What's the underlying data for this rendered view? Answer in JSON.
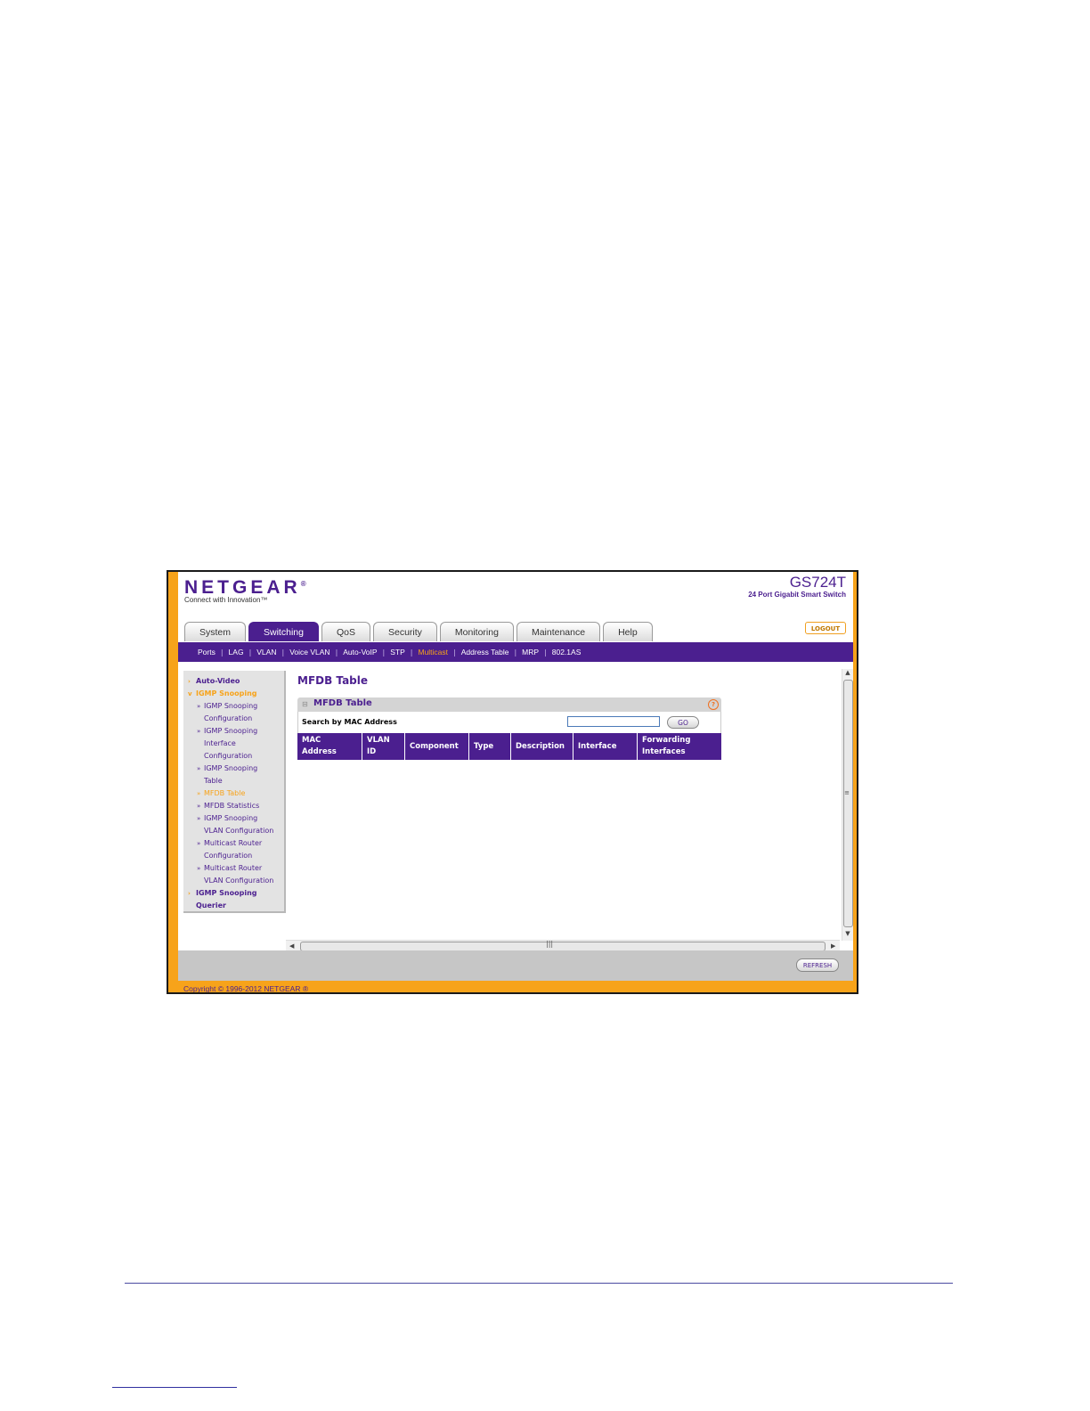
{
  "header": {
    "logo": "NETGEAR",
    "logo_mark": "®",
    "tagline": "Connect with Innovation™",
    "model": "GS724T",
    "model_desc": "24 Port Gigabit Smart Switch",
    "logout_label": "LOGOUT"
  },
  "tabs": [
    {
      "label": "System"
    },
    {
      "label": "Switching"
    },
    {
      "label": "QoS"
    },
    {
      "label": "Security"
    },
    {
      "label": "Monitoring"
    },
    {
      "label": "Maintenance"
    },
    {
      "label": "Help"
    }
  ],
  "subnav": [
    {
      "label": "Ports"
    },
    {
      "label": "LAG"
    },
    {
      "label": "VLAN"
    },
    {
      "label": "Voice VLAN"
    },
    {
      "label": "Auto-VoIP"
    },
    {
      "label": "STP"
    },
    {
      "label": "Multicast"
    },
    {
      "label": "Address Table"
    },
    {
      "label": "MRP"
    },
    {
      "label": "802.1AS"
    }
  ],
  "sidebar": {
    "items": [
      {
        "label": "Auto-Video"
      },
      {
        "label": "IGMP Snooping"
      },
      {
        "label": "IGMP Snooping"
      },
      {
        "label": "Configuration"
      },
      {
        "label": "IGMP Snooping"
      },
      {
        "label": "Interface"
      },
      {
        "label": "Configuration"
      },
      {
        "label": "IGMP Snooping"
      },
      {
        "label": "Table"
      },
      {
        "label": "MFDB Table"
      },
      {
        "label": "MFDB Statistics"
      },
      {
        "label": "IGMP Snooping"
      },
      {
        "label": "VLAN Configuration"
      },
      {
        "label": "Multicast Router"
      },
      {
        "label": "Configuration"
      },
      {
        "label": "Multicast Router"
      },
      {
        "label": "VLAN Configuration"
      },
      {
        "label": "IGMP Snooping"
      },
      {
        "label": "Querier"
      }
    ]
  },
  "main": {
    "page_title": "MFDB Table",
    "panel_title": "MFDB Table",
    "help_glyph": "?",
    "search_label": "Search by MAC Address",
    "search_value": "",
    "go_label": "GO",
    "columns": [
      {
        "line1": "MAC",
        "line2": "Address"
      },
      {
        "line1": "VLAN",
        "line2": "ID"
      },
      {
        "line1": "Component",
        "line2": ""
      },
      {
        "line1": "Type",
        "line2": ""
      },
      {
        "line1": "Description",
        "line2": ""
      },
      {
        "line1": "Interface",
        "line2": ""
      },
      {
        "line1": "Forwarding",
        "line2": "Interfaces"
      }
    ]
  },
  "footer": {
    "refresh_label": "REFRESH",
    "copyright": "Copyright © 1996-2012 NETGEAR ®"
  },
  "colors": {
    "brand_purple": "#4b1f8f",
    "accent_orange": "#f7a31a"
  }
}
